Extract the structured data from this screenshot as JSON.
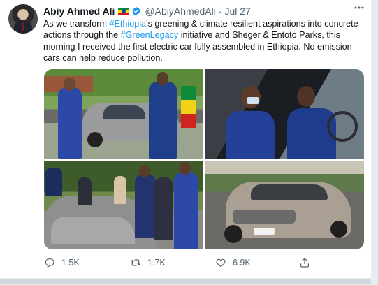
{
  "tweet": {
    "author": {
      "name": "Abiy Ahmed Ali",
      "handle": "@AbiyAhmedAli",
      "separator": "·",
      "date": "Jul 27"
    },
    "text_parts": {
      "t1": "As we transform ",
      "h1": "#Ethiopia",
      "t2": "’s greening & climate resilient aspirations into concrete actions through the ",
      "h2": "#GreenLegacy",
      "t3": " initiative and Sheger & Entoto Parks, this morning I received the first electric car fully assembled in Ethiopia. No emission cars can help reduce pollution."
    },
    "actions": {
      "replies": "1.5K",
      "retweets": "1.7K",
      "likes": "6.9K"
    },
    "icons": [
      "reply-icon",
      "retweet-icon",
      "like-icon",
      "share-icon",
      "more-icon",
      "verified-icon",
      "ethiopia-flag-icon"
    ],
    "colors": {
      "link": "#1d9bf0",
      "secondary_text": "#536471",
      "verified": "#1d9bf0"
    }
  }
}
